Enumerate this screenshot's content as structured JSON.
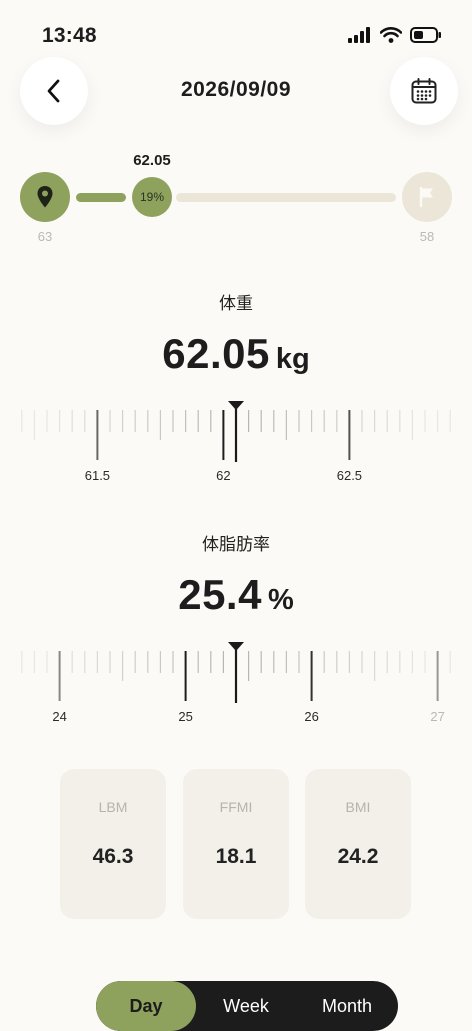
{
  "status_bar": {
    "time": "13:48"
  },
  "header": {
    "date": "2026/09/09",
    "back_icon": "chevron-left-icon",
    "calendar_icon": "calendar-icon"
  },
  "progress": {
    "current_value": "62.05",
    "percent_label": "19%",
    "percent": 19,
    "start_value": "63",
    "goal_value": "58",
    "colors": {
      "accent": "#8ea25e",
      "track": "#ebe6d8"
    }
  },
  "weight": {
    "title": "体重",
    "value": "62.05",
    "unit": "kg",
    "ruler": {
      "labels": [
        "61.5",
        "62",
        "62.5"
      ],
      "min": 61.5,
      "max": 62.5,
      "current": 62.05
    }
  },
  "body_fat": {
    "title": "体脂肪率",
    "value": "25.4",
    "unit": "%",
    "ruler": {
      "labels": [
        "24",
        "25",
        "26",
        "27"
      ],
      "min": 24,
      "max": 27,
      "current": 25.4
    }
  },
  "cards": [
    {
      "label": "LBM",
      "value": "46.3"
    },
    {
      "label": "FFMI",
      "value": "18.1"
    },
    {
      "label": "BMI",
      "value": "24.2"
    }
  ],
  "period_tabs": {
    "items": [
      "Day",
      "Week",
      "Month"
    ],
    "selected": "Day"
  }
}
